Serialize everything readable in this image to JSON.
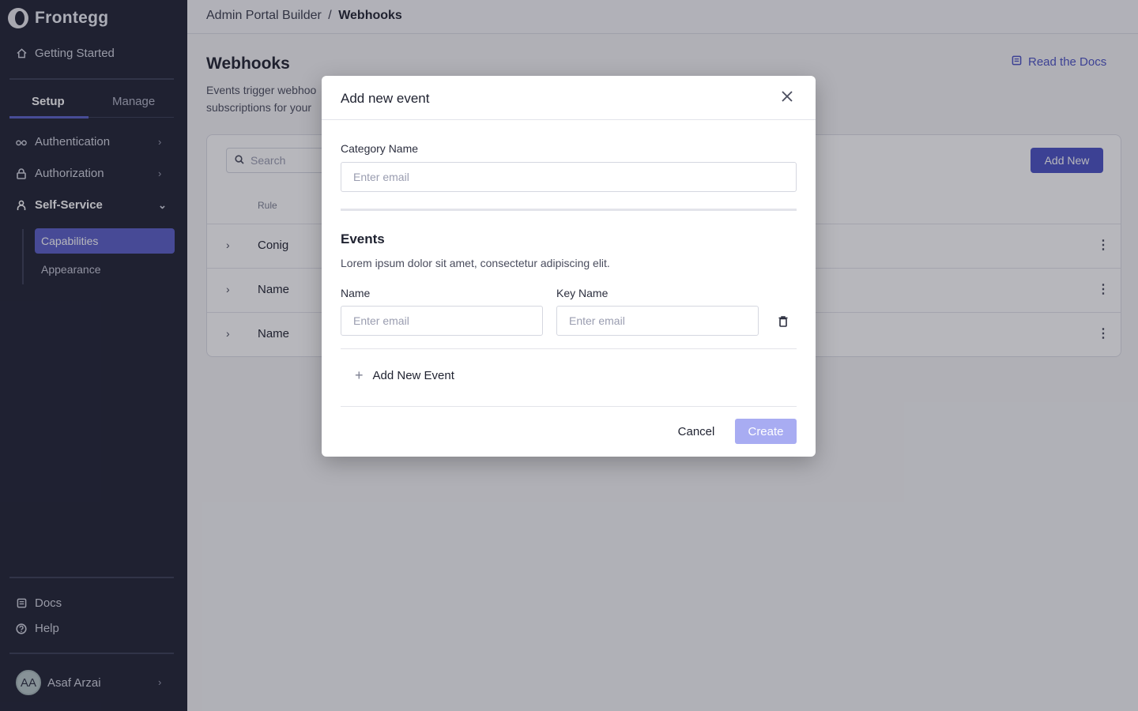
{
  "sidebar": {
    "brand": "Frontegg",
    "getting_started": "Getting Started",
    "tabs": [
      {
        "label": "Setup"
      },
      {
        "label": "Manage"
      }
    ],
    "items": [
      {
        "label": "Authentication"
      },
      {
        "label": "Authorization"
      },
      {
        "label": "Self-Service"
      }
    ],
    "sub_items": [
      {
        "label": "Capabilities"
      },
      {
        "label": "Appearance"
      }
    ],
    "footer": {
      "docs": "Docs",
      "help": "Help"
    },
    "user": {
      "initials": "AA",
      "name": "Asaf Arzai"
    }
  },
  "breadcrumb": {
    "parent": "Admin Portal Builder",
    "separator": "/",
    "current": "Webhooks"
  },
  "page": {
    "title": "Webhooks",
    "description_line1": "Events trigger webhoo",
    "description_line2": "subscriptions for your",
    "docs_link": "Read the Docs"
  },
  "table": {
    "search_placeholder": "Search",
    "add_new_label": "Add New",
    "column_rule": "Rule",
    "rows": [
      {
        "name": "Conig"
      },
      {
        "name": "Name"
      },
      {
        "name": "Name"
      }
    ]
  },
  "modal": {
    "title": "Add new event",
    "category_label": "Category Name",
    "category_placeholder": "Enter email",
    "events_title": "Events",
    "events_desc": "Lorem ipsum dolor sit amet, consectetur adipiscing elit.",
    "name_label": "Name",
    "name_placeholder": "Enter email",
    "key_label": "Key Name",
    "key_placeholder": "Enter email",
    "add_event_label": "Add New Event",
    "cancel_label": "Cancel",
    "create_label": "Create"
  },
  "colors": {
    "sidebar_bg": "#1f2233",
    "accent": "#5b5fc7",
    "primary_button": "#4b52c4",
    "disabled_button": "#a8acf2"
  }
}
